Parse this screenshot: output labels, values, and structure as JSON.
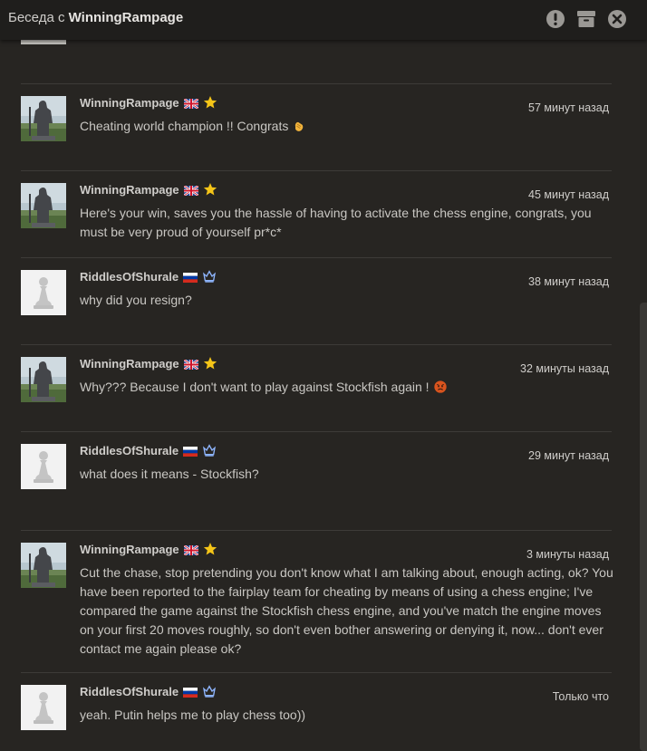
{
  "header": {
    "title_prefix": "Беседа с",
    "title_name": "WinningRampage"
  },
  "icons": {
    "report": "report-icon",
    "archive": "archive-icon",
    "close": "close-icon"
  },
  "colors": {
    "background": "#272522",
    "titlebar": "#1f1e1c",
    "text": "#c9c7c3",
    "star": "#f5c518",
    "crown": "#8fb6ff"
  },
  "messages": [
    {
      "user": "WinningRampage",
      "flag": "gb",
      "badge": "star",
      "time": "57 минут назад",
      "text": "Cheating world champion !! Congrats",
      "emoji": "clap"
    },
    {
      "user": "WinningRampage",
      "flag": "gb",
      "badge": "star",
      "time": "45 минут назад",
      "text": "Here's your win, saves you the hassle of having to activate the chess engine, congrats, you must be very proud of yourself pr*c*",
      "emoji": ""
    },
    {
      "user": "RiddlesOfShurale",
      "flag": "ru",
      "badge": "crown",
      "time": "38 минут назад",
      "text": "why did you resign?",
      "emoji": ""
    },
    {
      "user": "WinningRampage",
      "flag": "gb",
      "badge": "star",
      "time": "32 минуты назад",
      "text": "Why??? Because I don't want to play against Stockfish again !",
      "emoji": "angry"
    },
    {
      "user": "RiddlesOfShurale",
      "flag": "ru",
      "badge": "crown",
      "time": "29 минут назад",
      "text": "what does it means - Stockfish?",
      "emoji": ""
    },
    {
      "user": "WinningRampage",
      "flag": "gb",
      "badge": "star",
      "time": "3 минуты назад",
      "text": "Cut the chase, stop pretending you don't know what I am talking about, enough acting, ok? You have been reported to the fairplay team for cheating by means of using a chess engine; I've compared the game against the Stockfish chess engine, and you've match the engine moves on your first 20 moves roughly, so don't even bother answering or denying it, now... don't ever contact me again please ok?",
      "emoji": ""
    },
    {
      "user": "RiddlesOfShurale",
      "flag": "ru",
      "badge": "crown",
      "time": "Только что",
      "text": "yeah. Putin helps me to play chess too))",
      "emoji": ""
    }
  ]
}
